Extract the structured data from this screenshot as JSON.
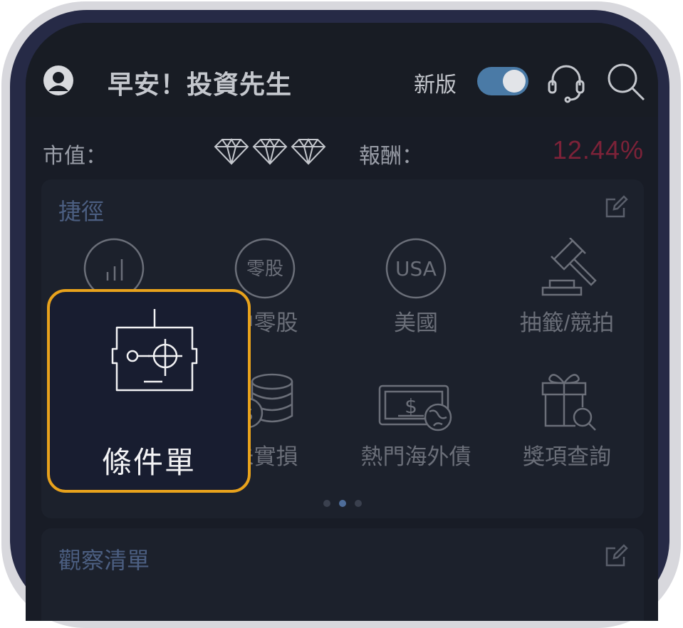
{
  "header": {
    "greeting": "早安！投資先生",
    "new_version_label": "新版",
    "new_version_on": true,
    "icons": [
      "avatar-icon",
      "headset-icon",
      "search-icon"
    ]
  },
  "summary": {
    "market_value_label": "市值：",
    "market_value_icon": "diamond-icon",
    "return_label": "報酬：",
    "return_value": "12.44%",
    "return_color": "#7c2238"
  },
  "shortcuts": {
    "title": "捷徑",
    "items": [
      {
        "label": "",
        "icon": "bar-chart-icon"
      },
      {
        "label": "中零股",
        "icon": "odd-lot-icon",
        "icon_text": "零股"
      },
      {
        "label": "美國",
        "icon": "usa-icon",
        "icon_text": "USA"
      },
      {
        "label": "抽籤/競拍",
        "icon": "gavel-icon"
      },
      {
        "label": "未實損",
        "icon": "coin-stack-icon"
      },
      {
        "label": "熱門海外債",
        "icon": "bond-icon",
        "icon_text": "$"
      },
      {
        "label": "獎項查詢",
        "icon": "gift-search-icon"
      }
    ],
    "page_count": 3,
    "active_page": 1
  },
  "watchlist": {
    "title": "觀察清單"
  },
  "highlight": {
    "label": "條件單",
    "icon": "robot-target-icon",
    "border_color": "#e8a21c"
  }
}
